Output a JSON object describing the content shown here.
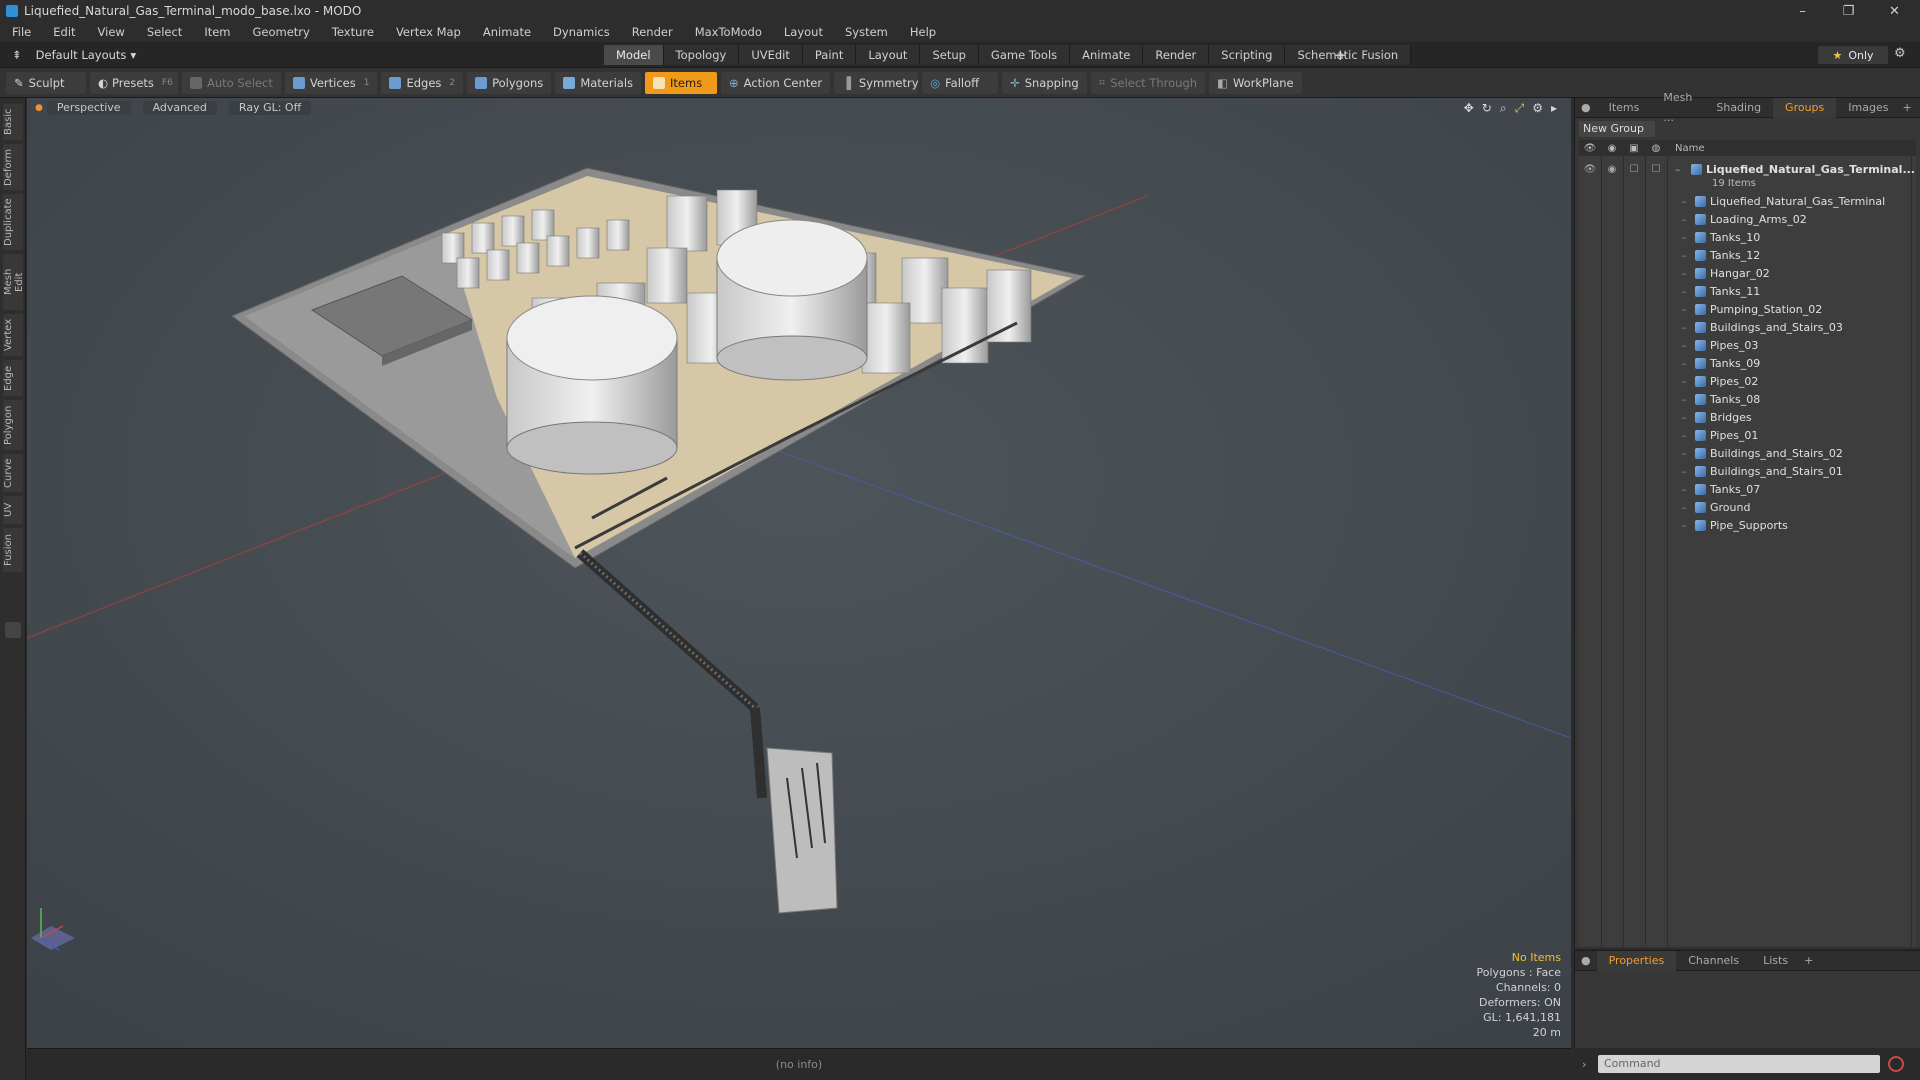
{
  "window": {
    "title": "Liquefied_Natural_Gas_Terminal_modo_base.lxo - MODO"
  },
  "menu": [
    "File",
    "Edit",
    "View",
    "Select",
    "Item",
    "Geometry",
    "Texture",
    "Vertex Map",
    "Animate",
    "Dynamics",
    "Render",
    "MaxToModo",
    "Layout",
    "System",
    "Help"
  ],
  "layout": {
    "selector": "Default Layouts",
    "only": "Only"
  },
  "tabs": [
    "Model",
    "Topology",
    "UVEdit",
    "Paint",
    "Layout",
    "Setup",
    "Game Tools",
    "Animate",
    "Render",
    "Scripting",
    "Schematic Fusion"
  ],
  "toolbar": {
    "sculpt": "Sculpt",
    "presets": "Presets",
    "presets_key": "F6",
    "auto_select": "Auto Select",
    "vertices": "Vertices",
    "vertices_key": "1",
    "edges": "Edges",
    "edges_key": "2",
    "polygons": "Polygons",
    "materials": "Materials",
    "items": "Items",
    "action_center": "Action Center",
    "symmetry": "Symmetry",
    "falloff": "Falloff",
    "snapping": "Snapping",
    "select_through": "Select Through",
    "workplane": "WorkPlane"
  },
  "left_tabs": [
    "Basic",
    "Deform",
    "Duplicate",
    "Mesh Edit",
    "Vertex",
    "Edge",
    "Polygon",
    "Curve",
    "UV",
    "Fusion"
  ],
  "viewport": {
    "view": "Perspective",
    "mode": "Advanced",
    "raygl": "Ray GL: Off",
    "info": {
      "no_items": "No Items",
      "polygons": "Polygons : Face",
      "channels": "Channels: 0",
      "deformers": "Deformers: ON",
      "gl": "GL: 1,641,181",
      "scale": "20 m"
    }
  },
  "status": {
    "text": "(no info)"
  },
  "right_panel": {
    "tabs": [
      "Items",
      "Mesh ...",
      "Shading",
      "Groups",
      "Images"
    ],
    "new_group": "New Group",
    "name_header": "Name",
    "root": {
      "name": "Liquefied_Natural_Gas_Terminal...",
      "count": "19 Items"
    },
    "items": [
      "Liquefied_Natural_Gas_Terminal",
      "Loading_Arms_02",
      "Tanks_10",
      "Tanks_12",
      "Hangar_02",
      "Tanks_11",
      "Pumping_Station_02",
      "Buildings_and_Stairs_03",
      "Pipes_03",
      "Tanks_09",
      "Pipes_02",
      "Tanks_08",
      "Bridges",
      "Pipes_01",
      "Buildings_and_Stairs_02",
      "Buildings_and_Stairs_01",
      "Tanks_07",
      "Ground",
      "Pipe_Supports"
    ]
  },
  "bottom_panel": {
    "tabs": [
      "Properties",
      "Channels",
      "Lists"
    ]
  },
  "command": {
    "placeholder": "Command"
  }
}
